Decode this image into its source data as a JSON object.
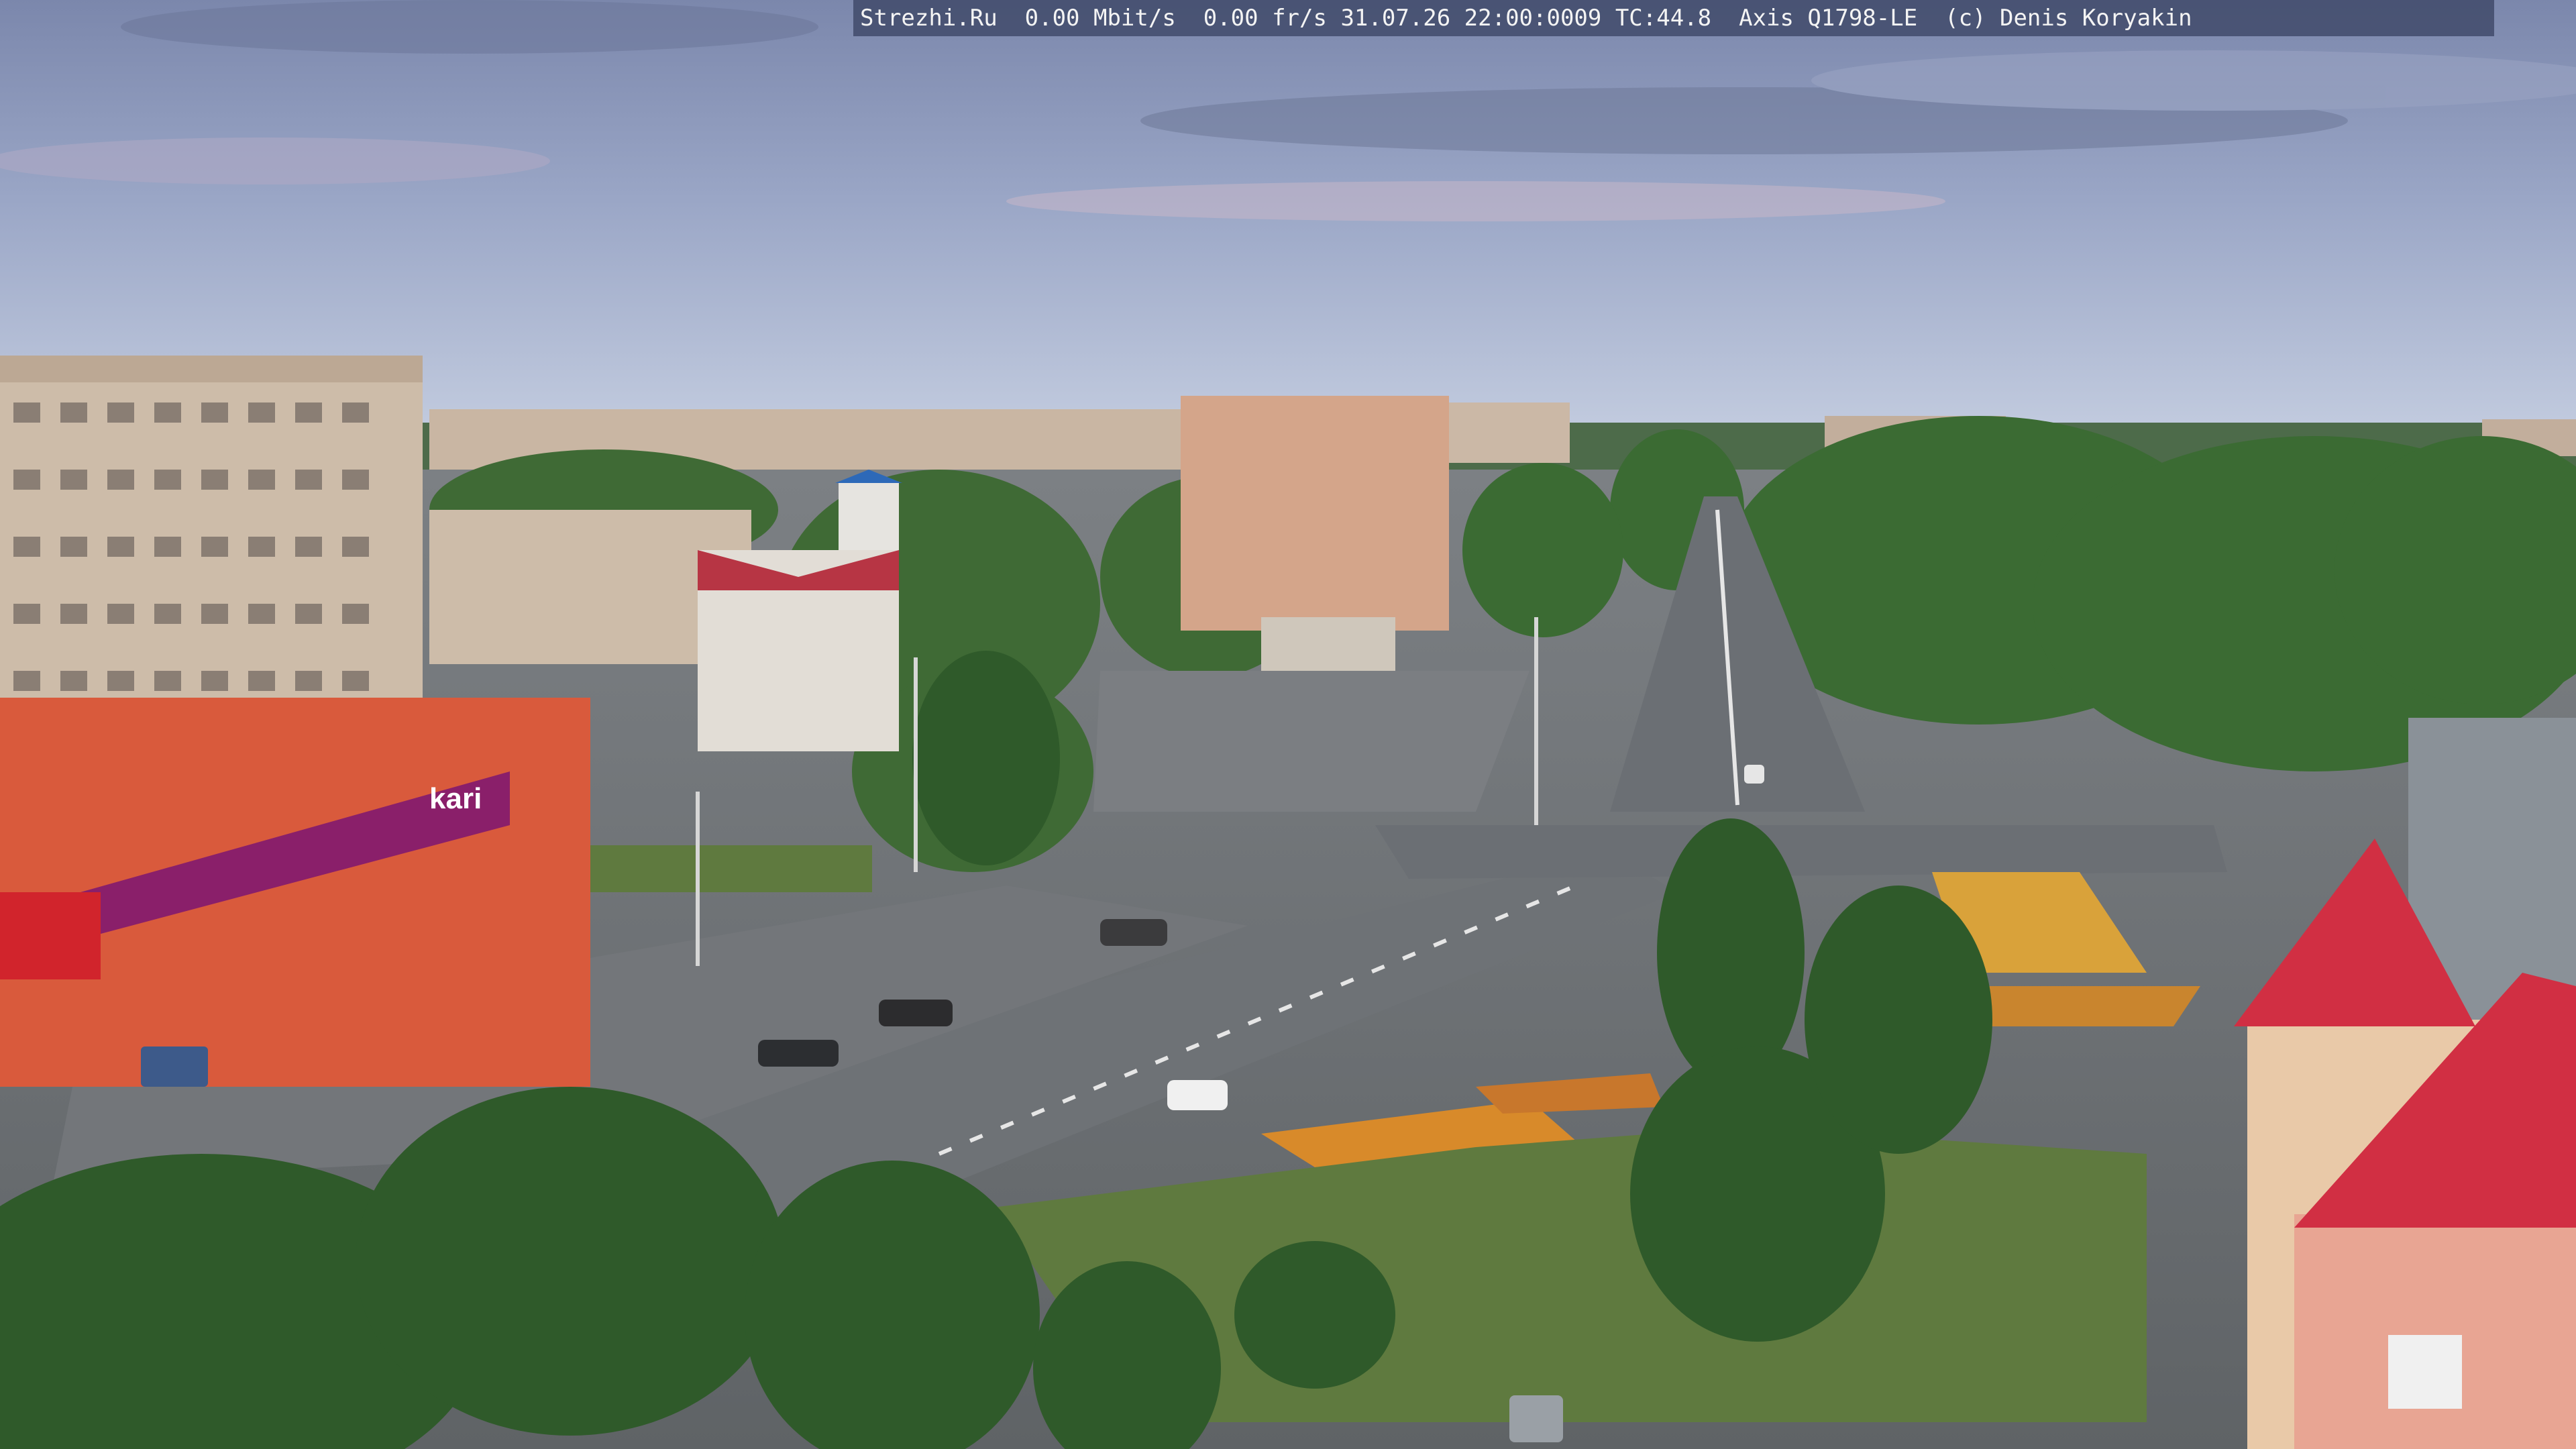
{
  "overlay": {
    "text": "Strezhi.Ru  0.00 Mbit/s  0.00 fr/s 31.07.26 22:00:0009 TC:44.8  Axis Q1798-LE  (c) Denis Koryakin"
  },
  "store_sign": {
    "brand": "kari"
  },
  "colors": {
    "sky_top": "#7d8ab0",
    "sky_horizon": "#bcc6dc",
    "foliage": "#3d6b34",
    "asphalt": "#6f7378",
    "brick_building": "#c9b8a6",
    "red_roof": "#d93a4a",
    "store_facade": "#d95a3c",
    "store_banner": "#8a1f6a"
  }
}
